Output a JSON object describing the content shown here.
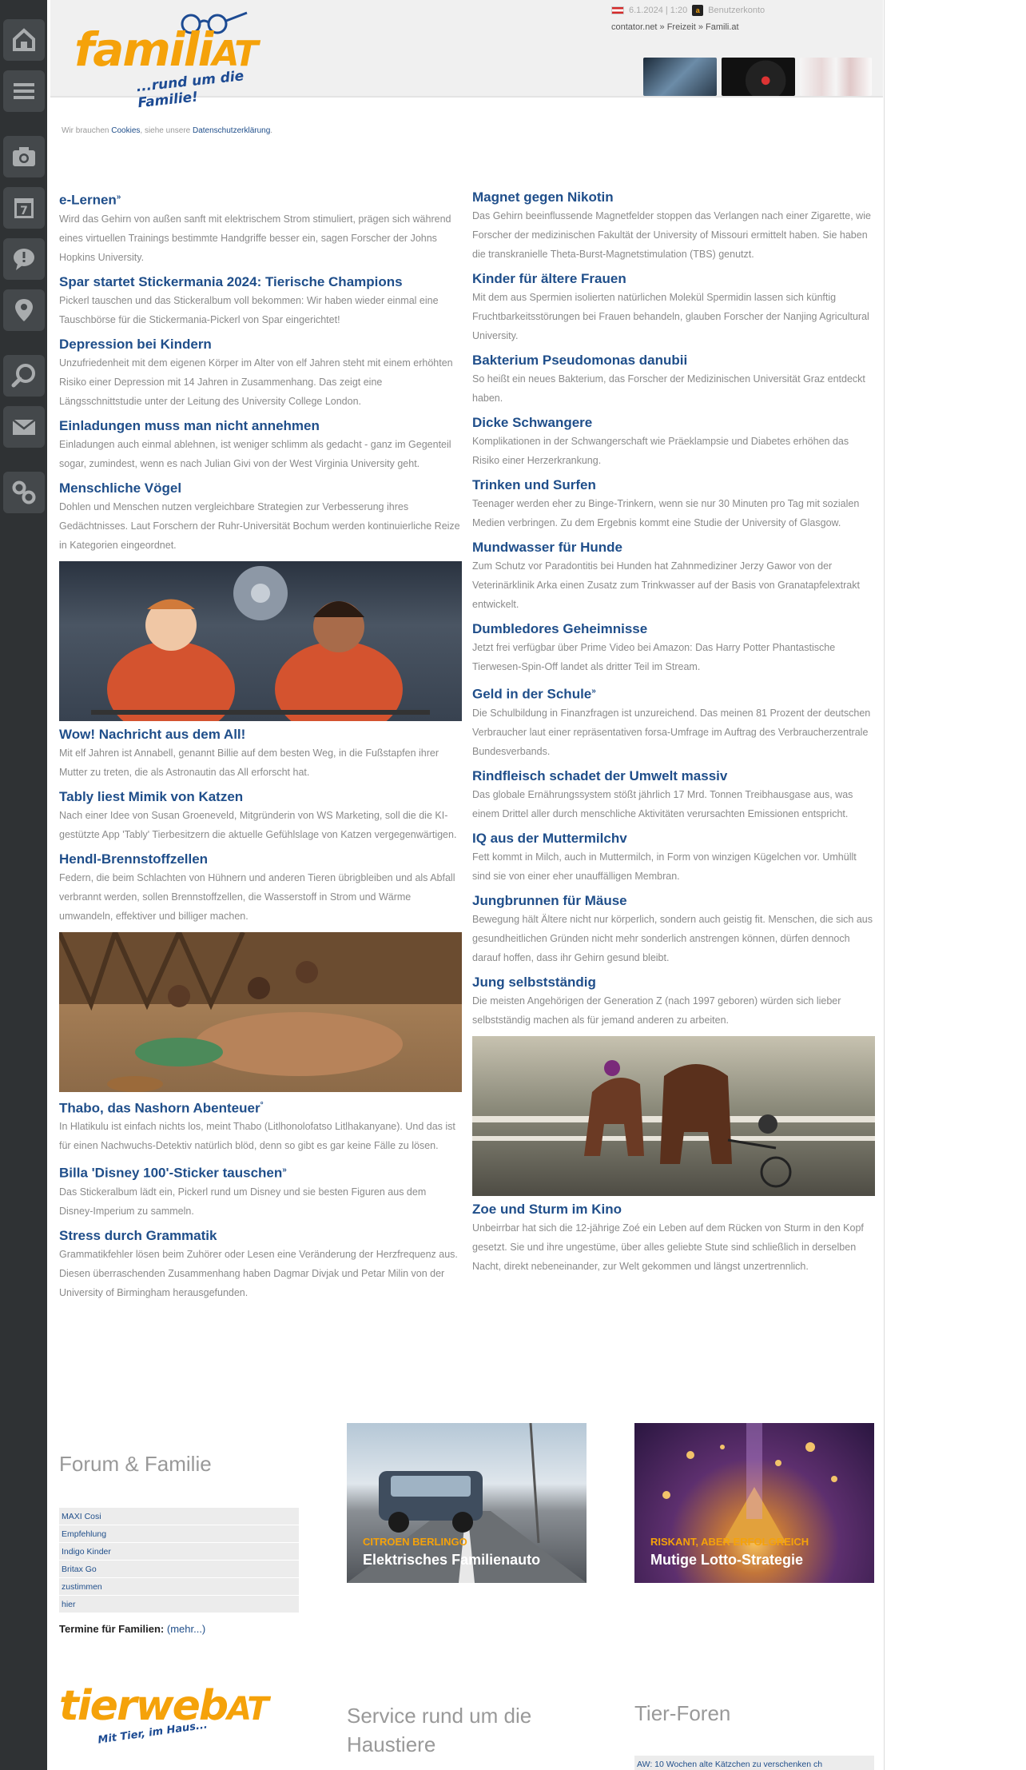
{
  "header": {
    "logo_text": "famili",
    "logo_suffix": "AT",
    "logo_tagline": "...rund um die Familie!",
    "date_time": "6.1.2024 | 1:20",
    "user_label": "Benutzerkonto",
    "breadcrumb": "contator.net » Freizeit » Famili.at"
  },
  "cookie": {
    "prefix": "Wir brauchen ",
    "cookies_link": "Cookies",
    "middle": ", siehe unsere ",
    "privacy_link": "Datenschutzerklärung",
    "suffix": "."
  },
  "sidebar": {
    "icons": [
      "home-icon",
      "menu-icon",
      "camera-icon",
      "calendar-icon",
      "chat-icon",
      "location-icon",
      "search-icon",
      "mail-icon",
      "settings-icon"
    ],
    "calendar_day": "7"
  },
  "left_articles": [
    {
      "title": "e-Lernen",
      "mark": "»",
      "text": "Wird das Gehirn von außen sanft mit elektrischem Strom stimuliert, prägen sich während eines virtuellen Trainings bestimmte Handgriffe besser ein, sagen Forscher der Johns Hopkins University."
    },
    {
      "title": "Spar startet Stickermania 2024: Tierische Champions",
      "mark": "",
      "text": "Pickerl tauschen und das Stickeralbum voll bekommen: Wir haben wieder einmal eine Tauschbörse für die Stickermania-Pickerl von Spar eingerichtet!"
    },
    {
      "title": "Depression bei Kindern",
      "mark": "",
      "text": "Unzufriedenheit mit dem eigenen Körper im Alter von elf Jahren steht mit einem erhöhten Risiko einer Depression mit 14 Jahren in Zusammenhang. Das zeigt eine Längsschnittstudie unter der Leitung des University College London."
    },
    {
      "title": "Einladungen muss man nicht annehmen",
      "mark": "",
      "text": "Einladungen auch einmal ablehnen, ist weniger schlimm als gedacht - ganz im Gegenteil sogar, zumindest, wenn es nach Julian Givi von der West Virginia University geht."
    },
    {
      "title": "Menschliche Vögel",
      "mark": "",
      "text": "Dohlen und Menschen nutzen vergleichbare Strategien zur Verbesserung ihres Gedächtnisses. Laut Forschern der Ruhr-Universität Bochum werden kontinuierliche Reize in Kategorien eingeordnet."
    },
    {
      "title": "Wow! Nachricht aus dem All!",
      "mark": "",
      "image": "astronaut-kids",
      "text": "Mit elf Jahren ist Annabell, genannt Billie auf dem besten Weg, in die Fußstapfen ihrer Mutter zu treten, die als Astronautin das All erforscht hat."
    },
    {
      "title": "Tably liest Mimik von Katzen",
      "mark": "",
      "text": "Nach einer Idee von Susan Groeneveld, Mitgründerin von WS Marketing, soll die die KI-gestützte App 'Tably' Tierbesitzern die aktuelle Gefühlslage von Katzen vergegenwärtigen."
    },
    {
      "title": "Hendl-Brennstoffzellen",
      "mark": "",
      "text": "Federn, die beim Schlachten von Hühnern und anderen Tieren übrigbleiben und als Abfall verbrannt werden, sollen Brennstoffzellen, die Wasserstoff in Strom und Wärme umwandeln, effektiver und billiger machen."
    },
    {
      "title": "Thabo, das Nashorn Abenteuer",
      "mark": "°",
      "image": "rhino-kids",
      "text": "In Hlatikulu ist einfach nichts los, meint Thabo (Litlhonolofatso Litlhakanyane). Und das ist für einen Nachwuchs-Detektiv natürlich blöd, denn so gibt es gar keine Fälle zu lösen."
    },
    {
      "title": "Billa 'Disney 100'-Sticker tauschen",
      "mark": "»",
      "text": "Das Stickeralbum lädt ein, Pickerl rund um Disney und sie besten Figuren aus dem Disney-Imperium zu sammeln."
    },
    {
      "title": "Stress durch Grammatik",
      "mark": "",
      "text": "Grammatikfehler lösen beim Zuhörer oder Lesen eine Veränderung der Herzfrequenz aus. Diesen überraschenden Zusammenhang haben Dagmar Divjak und Petar Milin von der University of Birmingham herausgefunden."
    }
  ],
  "right_articles": [
    {
      "title": "Magnet gegen Nikotin",
      "mark": "",
      "text": "Das Gehirn beeinflussende Magnetfelder stoppen das Verlangen nach einer Zigarette, wie Forscher der medizinischen Fakultät der University of Missouri ermittelt haben. Sie haben die transkranielle Theta-Burst-Magnetstimulation (TBS) genutzt."
    },
    {
      "title": "Kinder für ältere Frauen",
      "mark": "",
      "text": "Mit dem aus Spermien isolierten natürlichen Molekül Spermidin lassen sich künftig Fruchtbarkeitsstörungen bei Frauen behandeln, glauben Forscher der Nanjing Agricultural University."
    },
    {
      "title": "Bakterium Pseudomonas danubii",
      "mark": "",
      "text": "So heißt ein neues Bakterium, das Forscher der Medizinischen Universität Graz entdeckt haben."
    },
    {
      "title": "Dicke Schwangere",
      "mark": "",
      "text": "Komplikationen in der Schwangerschaft wie Präeklampsie und Diabetes erhöhen das Risiko einer Herzerkrankung."
    },
    {
      "title": "Trinken und Surfen",
      "mark": "",
      "text": "Teenager werden eher zu Binge-Trinkern, wenn sie nur 30 Minuten pro Tag mit sozialen Medien verbringen. Zu dem Ergebnis kommt eine Studie der University of Glasgow."
    },
    {
      "title": "Mundwasser für Hunde",
      "mark": "",
      "text": "Zum Schutz vor Paradontitis bei Hunden hat Zahnmediziner Jerzy Gawor von der Veterinärklinik Arka einen Zusatz zum Trinkwasser auf der Basis von Granatapfelextrakt entwickelt."
    },
    {
      "title": "Dumbledores Geheimnisse",
      "mark": "",
      "text": "Jetzt frei verfügbar über Prime Video bei Amazon: Das Harry Potter Phantastische Tierwesen-Spin-Off landet als dritter Teil im Stream."
    },
    {
      "title": "Geld in der Schule",
      "mark": "»",
      "text": "Die Schulbildung in Finanzfragen ist unzureichend. Das meinen 81 Prozent der deutschen Verbraucher laut einer repräsentativen forsa-Umfrage im Auftrag des Verbraucherzentrale Bundesverbands."
    },
    {
      "title": "Rindfleisch schadet der Umwelt massiv",
      "mark": "",
      "text": "Das globale Ernährungssystem stößt jährlich 17 Mrd. Tonnen Treibhausgase aus, was einem Drittel aller durch menschliche Aktivitäten verursachten Emissionen entspricht."
    },
    {
      "title": "IQ aus der Muttermilchv",
      "mark": "",
      "text": "Fett kommt in Milch, auch in Muttermilch, in Form von winzigen Kügelchen vor. Umhüllt sind sie von einer eher unauffälligen Membran."
    },
    {
      "title": "Jungbrunnen für Mäuse",
      "mark": "",
      "text": "Bewegung hält Ältere nicht nur körperlich, sondern auch geistig fit. Menschen, die sich aus gesundheitlichen Gründen nicht mehr sonderlich anstrengen können, dürfen dennoch darauf hoffen, dass ihr Gehirn gesund bleibt."
    },
    {
      "title": "Jung selbstständig",
      "mark": "",
      "text": "Die meisten Angehörigen der Generation Z (nach 1997 geboren) würden sich lieber selbstständig machen als für jemand anderen zu arbeiten."
    },
    {
      "title": "Zoe und Sturm im Kino",
      "mark": "",
      "image": "horses",
      "text": "Unbeirrbar hat sich die 12-jährige Zoé ein Leben auf dem Rücken von Sturm in den Kopf gesetzt. Sie und ihre ungestüme, über alles geliebte Stute sind schließlich in derselben Nacht, direkt nebeneinander, zur Welt gekommen und längst unzertrennlich."
    }
  ],
  "forum": {
    "title": "Forum & Familie",
    "items": [
      "MAXI Cosi",
      "Empfehlung",
      "Indigo Kinder",
      "Britax Go",
      "zustimmen",
      "hier"
    ],
    "termine_label": "Termine für Familien:",
    "termine_more": "(mehr...)"
  },
  "promos": [
    {
      "kicker": "CITROEN BERLINGO",
      "title": "Elektrisches Familienauto"
    },
    {
      "kicker": "RISKANT, ABER ERFOLGREICH",
      "title": "Mutige Lotto-Strategie"
    }
  ],
  "footer": {
    "tierweb_text": "tierweb",
    "tierweb_suffix": "AT",
    "tierweb_tagline": "Mit Tier, im Haus...",
    "service_title": "Service rund um die Haustiere",
    "tierforen_title": "Tier-Foren",
    "tierforen_items": [
      "AW: 10 Wochen alte Kätzchen zu verschenken ch"
    ]
  },
  "colors": {
    "accent_orange": "#f5a20a",
    "link_blue": "#1f4e8a",
    "sidebar_dark": "#2f3234"
  }
}
